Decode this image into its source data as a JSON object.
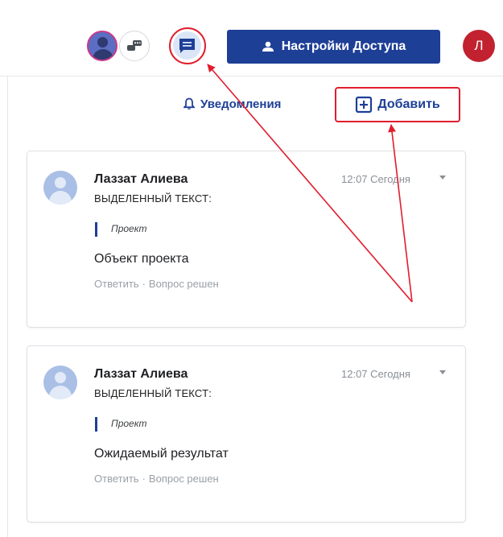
{
  "header": {
    "access_button_label": "Настройки Доступа",
    "user_initial": "Л"
  },
  "panel": {
    "notifications_label": "Уведомления",
    "add_label": "Добавить"
  },
  "comments": [
    {
      "author": "Лаззат Алиева",
      "time": "12:07 Сегодня",
      "selected_label": "ВЫДЕЛЕННЫЙ ТЕКСТ:",
      "quote": "Проект",
      "text": "Объект проекта",
      "reply_label": "Ответить",
      "separator": "·",
      "resolve_label": "Вопрос решен"
    },
    {
      "author": "Лаззат Алиева",
      "time": "12:07 Сегодня",
      "selected_label": "ВЫДЕЛЕННЫЙ ТЕКСТ:",
      "quote": "Проект",
      "text": "Ожидаемый результат",
      "reply_label": "Ответить",
      "separator": "·",
      "resolve_label": "Вопрос решен"
    }
  ],
  "colors": {
    "brand_blue": "#1d3f96",
    "highlight_red": "#e11d2d",
    "user_avatar_red": "#c2222f",
    "chat_button_bg": "#dbe5f8"
  },
  "icons": [
    "user-avatar-icon",
    "chat-bubbles-icon",
    "comment-icon",
    "person-icon",
    "bell-icon",
    "add-box-icon",
    "caret-down-icon"
  ]
}
